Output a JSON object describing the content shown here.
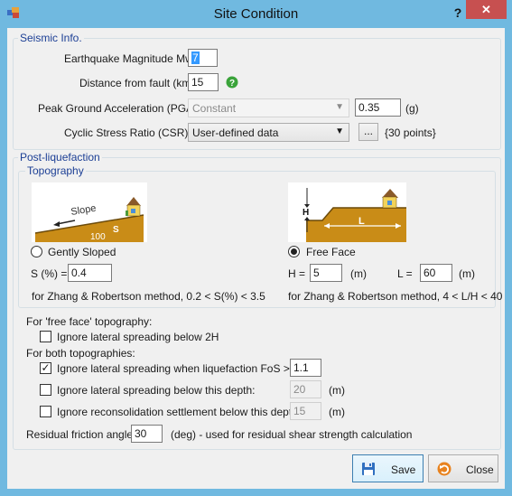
{
  "window": {
    "title": "Site Condition",
    "help": "?",
    "close": "✕"
  },
  "seismic": {
    "group_label": "Seismic Info.",
    "magnitude_label": "Earthquake Magnitude Mw:",
    "magnitude_value": "7",
    "distance_label": "Distance from fault (km) :",
    "distance_value": "15",
    "pga_label": "Peak Ground Acceleration (PGA):",
    "pga_option": "Constant",
    "pga_value": "0.35",
    "pga_unit": "(g)",
    "csr_label": "Cyclic Stress Ratio (CSR):",
    "csr_option": "User-defined data",
    "csr_more": "...",
    "csr_points": "{30 points}"
  },
  "post": {
    "group_label": "Post-liquefaction",
    "topography_label": "Topography",
    "gentle": {
      "radio_label": "Gently Sloped",
      "s_label": "S (%) =",
      "s_value": "0.4",
      "note": "for Zhang & Robertson method, 0.2 < S(%) < 3.5",
      "img_slope": "Slope",
      "img_100": "100",
      "img_s": "S"
    },
    "free": {
      "radio_label": "Free Face",
      "h_label": "H =",
      "h_value": "5",
      "h_unit": "(m)",
      "l_label": "L =",
      "l_value": "60",
      "l_unit": "(m)",
      "note": "for Zhang & Robertson method, 4 < L/H < 40",
      "img_h": "H",
      "img_l": "L"
    },
    "free_face_header": "For 'free face' topography:",
    "ignore_2h": "Ignore lateral spreading below 2H",
    "both_header": "For both topographies:",
    "ignore_fos_label": "Ignore lateral spreading when liquefaction FoS >",
    "ignore_fos_value": "1.1",
    "ignore_depth_label": "Ignore lateral spreading below this depth:",
    "ignore_depth_value": "20",
    "ignore_depth_unit": "(m)",
    "ignore_reconsol_label": "Ignore reconsolidation settlement below this depth:",
    "ignore_reconsol_value": "15",
    "ignore_reconsol_unit": "(m)",
    "residual_label": "Residual friction angle:",
    "residual_value": "30",
    "residual_note": "(deg) - used for residual shear strength calculation"
  },
  "buttons": {
    "save": "Save",
    "close": "Close"
  }
}
